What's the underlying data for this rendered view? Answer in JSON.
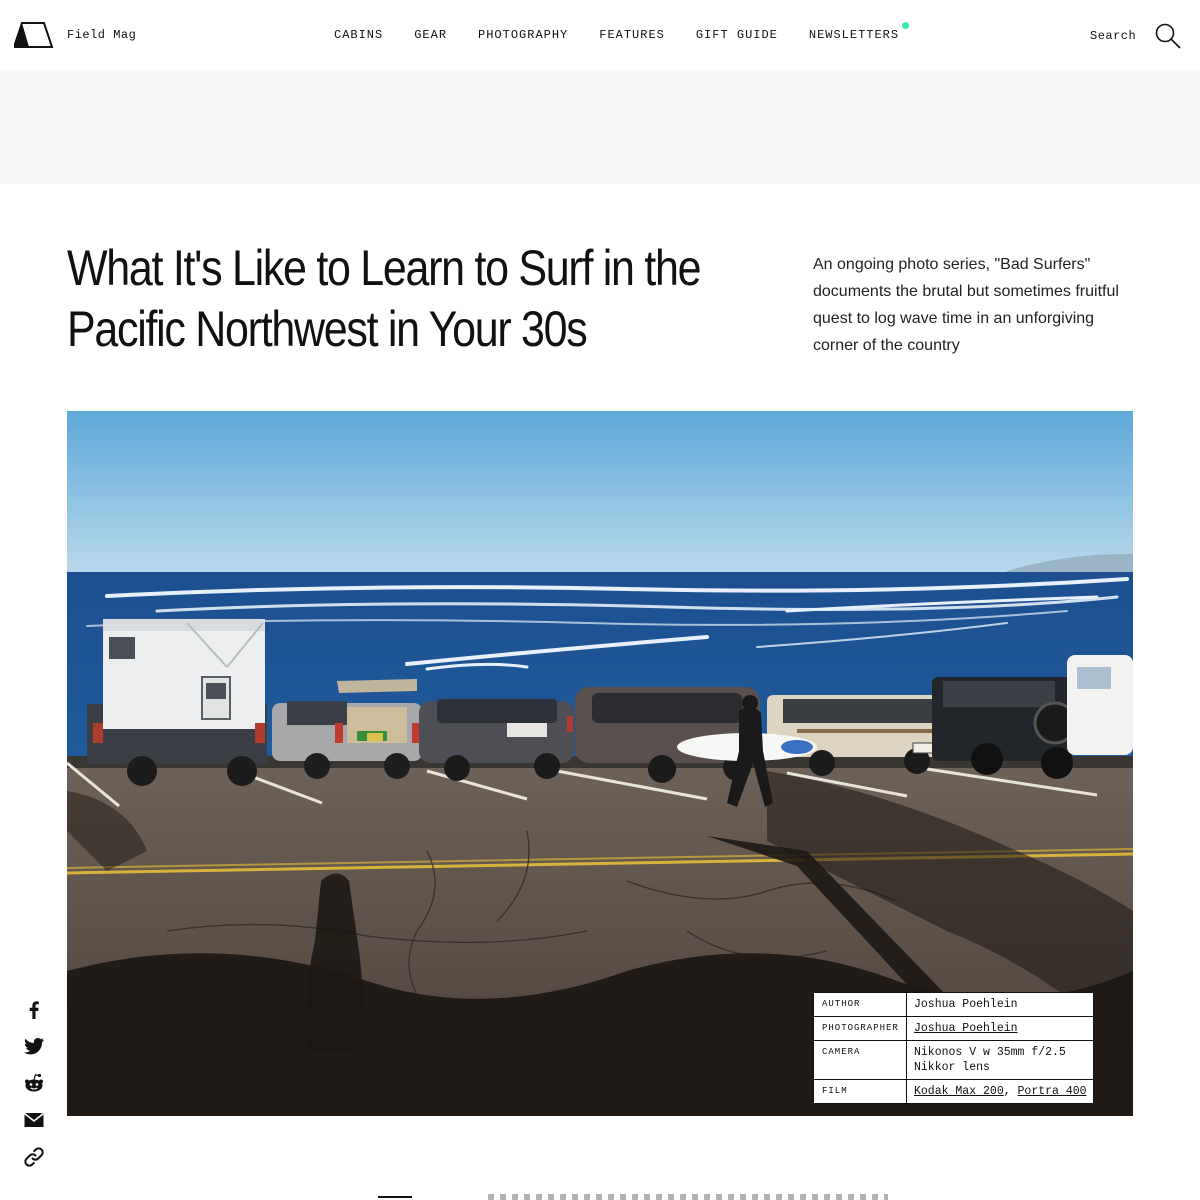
{
  "header": {
    "brand": "Field Mag",
    "nav": [
      {
        "label": "CABINS"
      },
      {
        "label": "GEAR"
      },
      {
        "label": "PHOTOGRAPHY"
      },
      {
        "label": "FEATURES"
      },
      {
        "label": "GIFT GUIDE"
      },
      {
        "label": "NEWSLETTERS"
      }
    ],
    "search_label": "Search"
  },
  "article": {
    "title": "What It's Like to Learn to Surf in the Pacific Northwest in Your 30s",
    "dek": "An ongoing photo series, \"Bad Surfers\" documents the brutal but sometimes fruitful quest to log wave time in an unforgiving corner of the country"
  },
  "credits": {
    "author_key": "AUTHOR",
    "author_value": "Joshua Poehlein",
    "photographer_key": "PHOTOGRAPHER",
    "photographer_value": "Joshua Poehlein",
    "camera_key": "CAMERA",
    "camera_value": "Nikonos V w 35mm f/2.5 Nikkor lens",
    "film_key": "FILM",
    "film_value_1": "Kodak Max 200",
    "film_sep": ",",
    "film_value_2": "Portra 400"
  },
  "share": {
    "icons": [
      "facebook-icon",
      "twitter-icon",
      "reddit-icon",
      "email-icon",
      "link-icon"
    ]
  },
  "colors": {
    "accent_dot": "#3ee8b5",
    "ad_band": "#f8f8f8",
    "text": "#111111"
  }
}
